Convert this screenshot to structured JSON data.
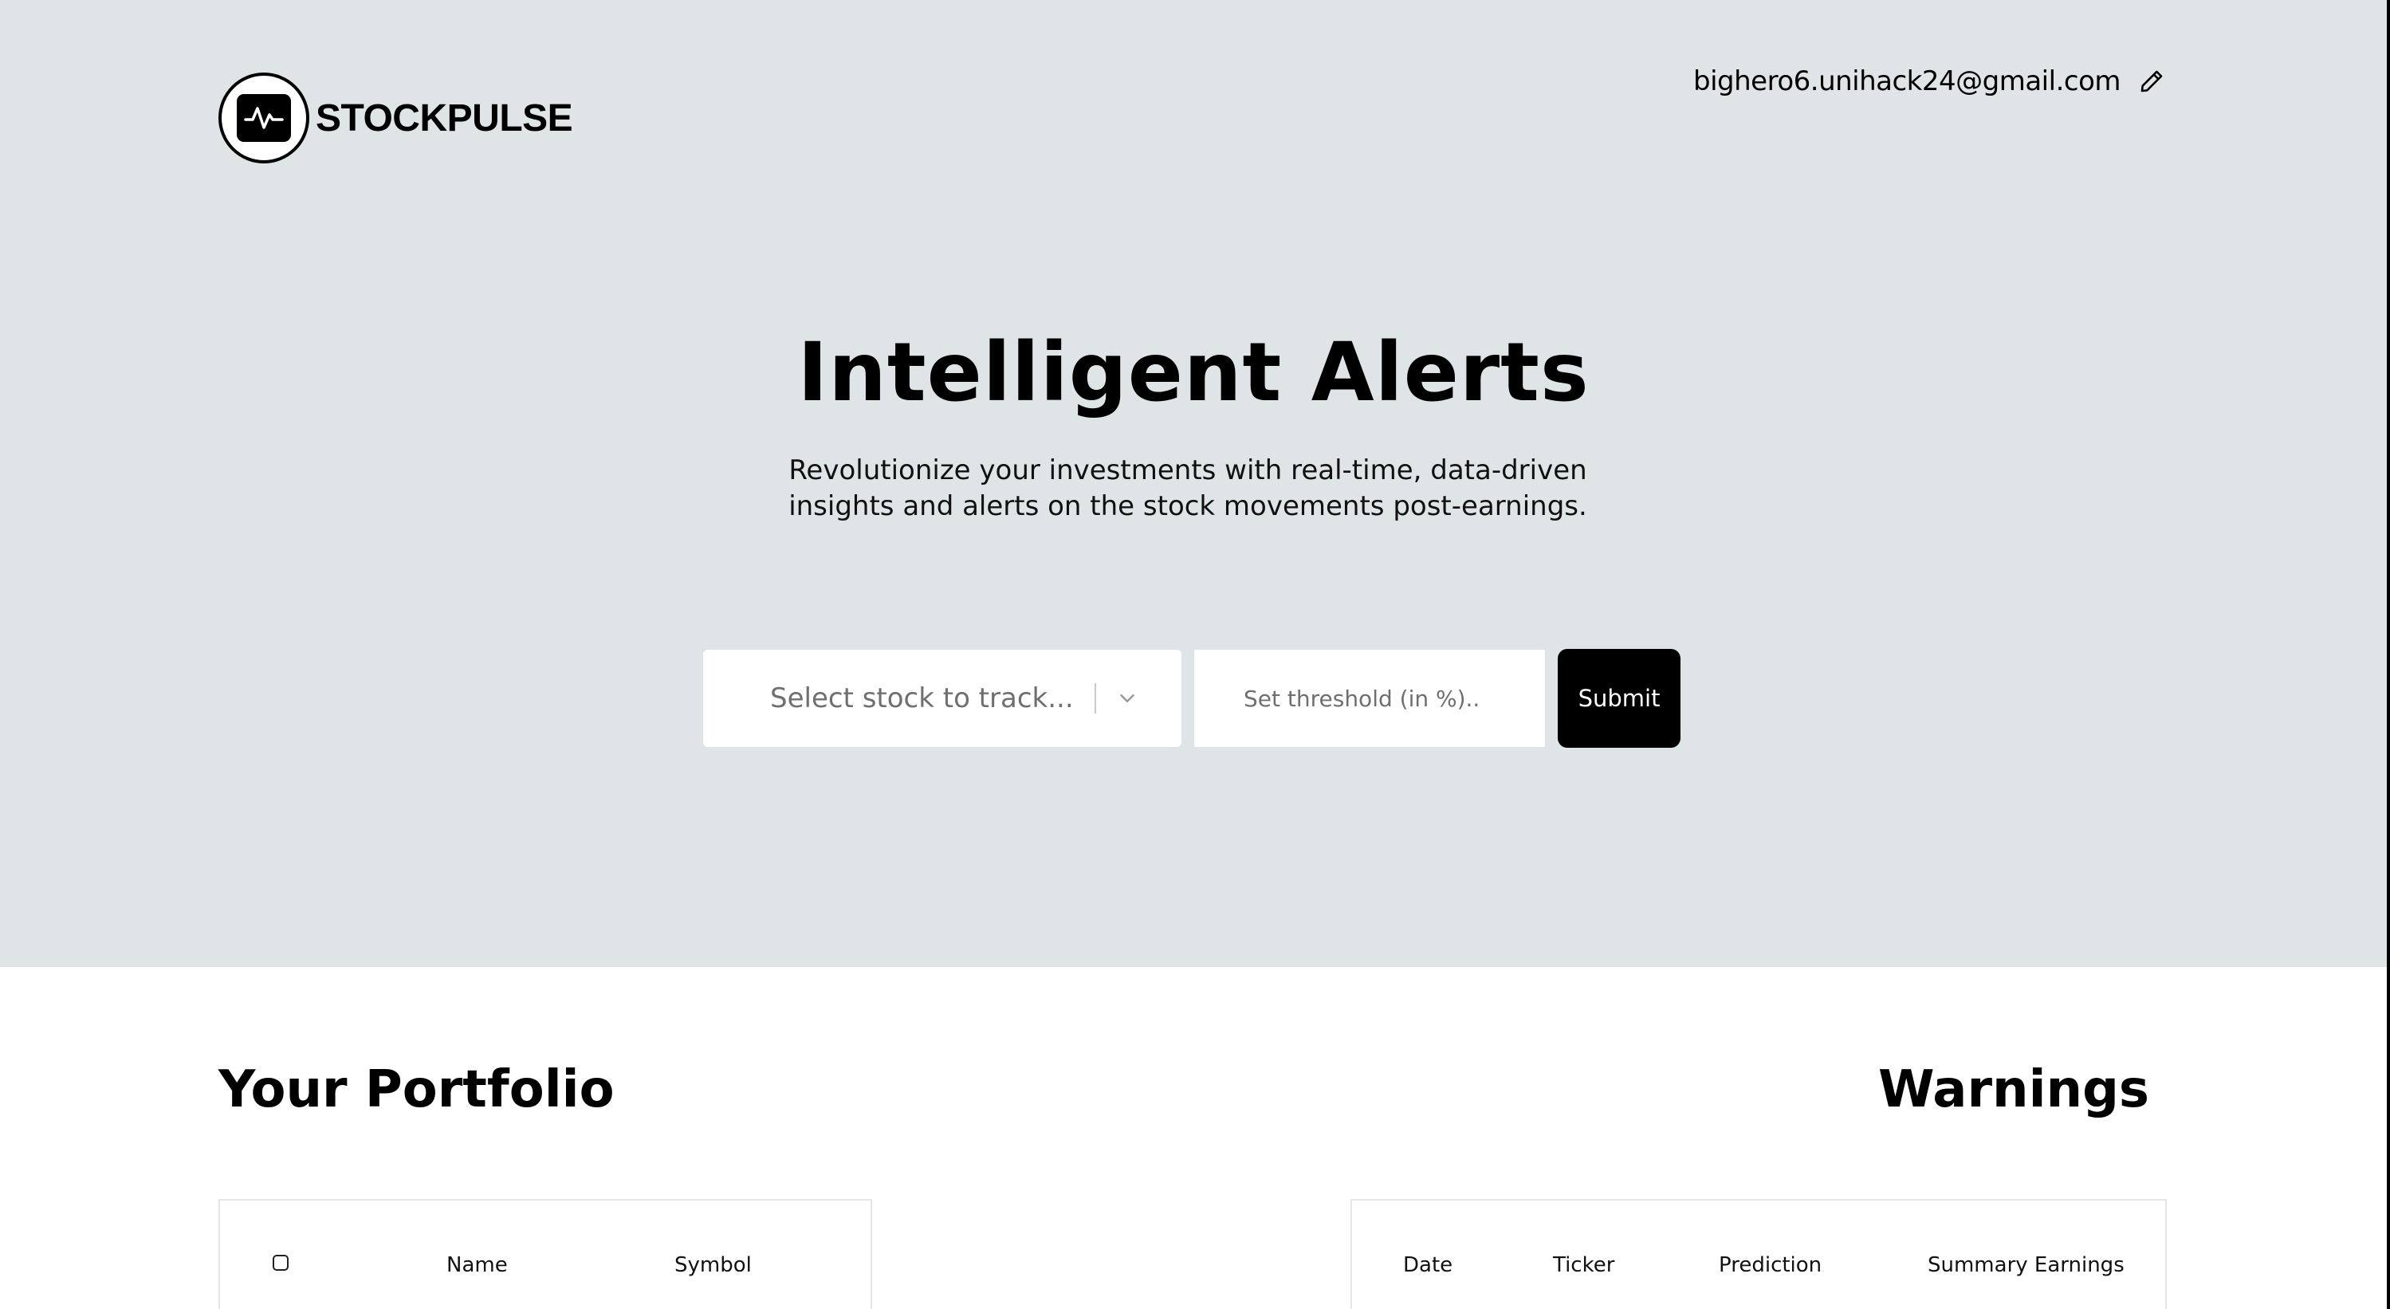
{
  "header": {
    "brand": "STOCKPULSE",
    "email": "bighero6.unihack24@gmail.com"
  },
  "hero": {
    "title": "Intelligent Alerts",
    "subtitle_line1": "Revolutionize your investments with real-time, data-driven",
    "subtitle_line2": "insights and alerts on the stock movements post-earnings."
  },
  "form": {
    "stock_placeholder": "Select stock to track...",
    "threshold_placeholder": "Set threshold (in %)..",
    "submit_label": "Submit"
  },
  "portfolio": {
    "title": "Your Portfolio",
    "columns": [
      "Name",
      "Symbol"
    ]
  },
  "warnings": {
    "title": "Warnings",
    "columns": [
      "Date",
      "Ticker",
      "Prediction",
      "Summary Earnings"
    ]
  },
  "colors": {
    "hero_bg": "#dfe4e6",
    "accent": "#000000"
  },
  "icons": [
    "pulse-logo-icon",
    "pencil-icon",
    "chevron-down-icon"
  ]
}
